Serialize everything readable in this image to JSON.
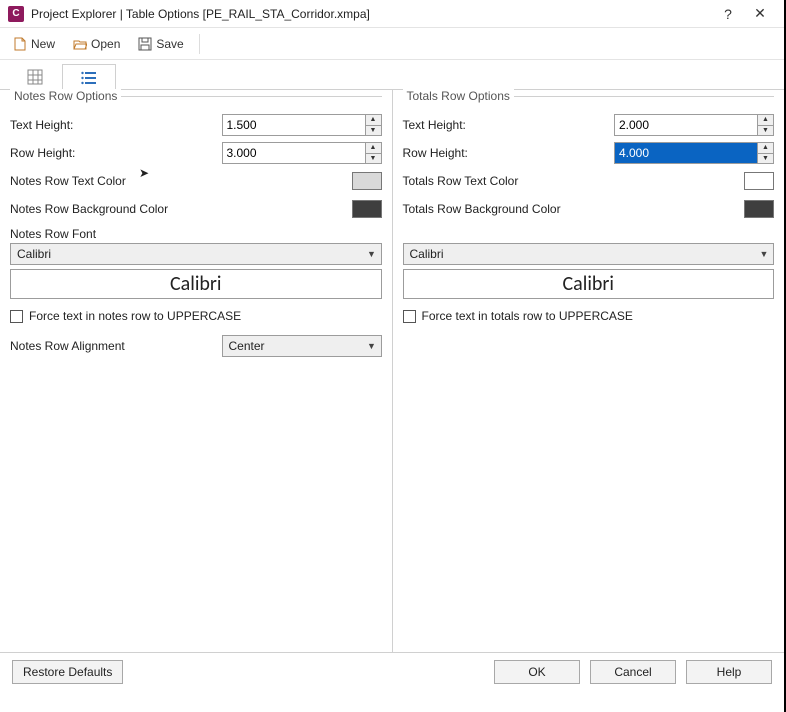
{
  "window": {
    "title": "Project Explorer | Table Options [PE_RAIL_STA_Corridor.xmpa]",
    "app_icon_letter": "C"
  },
  "toolbar": {
    "new_label": "New",
    "open_label": "Open",
    "save_label": "Save"
  },
  "panels": {
    "notes": {
      "title": "Notes Row Options",
      "text_height_label": "Text Height:",
      "text_height_value": "1.500",
      "row_height_label": "Row Height:",
      "row_height_value": "3.000",
      "text_color_label": "Notes Row Text Color",
      "text_color_value": "#d9d9d9",
      "bg_color_label": "Notes Row Background Color",
      "bg_color_value": "#3f3f3f",
      "font_label": "Notes Row Font",
      "font_value": "Calibri",
      "font_preview": "Calibri",
      "uppercase_label": "Force text in notes row to UPPERCASE",
      "alignment_label": "Notes Row Alignment",
      "alignment_value": "Center"
    },
    "totals": {
      "title": "Totals Row Options",
      "text_height_label": "Text Height:",
      "text_height_value": "2.000",
      "row_height_label": "Row Height:",
      "row_height_value": "4.000",
      "text_color_label": "Totals Row Text Color",
      "text_color_value": "#ffffff",
      "bg_color_label": "Totals Row Background Color",
      "bg_color_value": "#3f3f3f",
      "font_value": "Calibri",
      "font_preview": "Calibri",
      "uppercase_label": "Force text in totals row to UPPERCASE"
    }
  },
  "bottom": {
    "restore": "Restore Defaults",
    "ok": "OK",
    "cancel": "Cancel",
    "help": "Help"
  }
}
